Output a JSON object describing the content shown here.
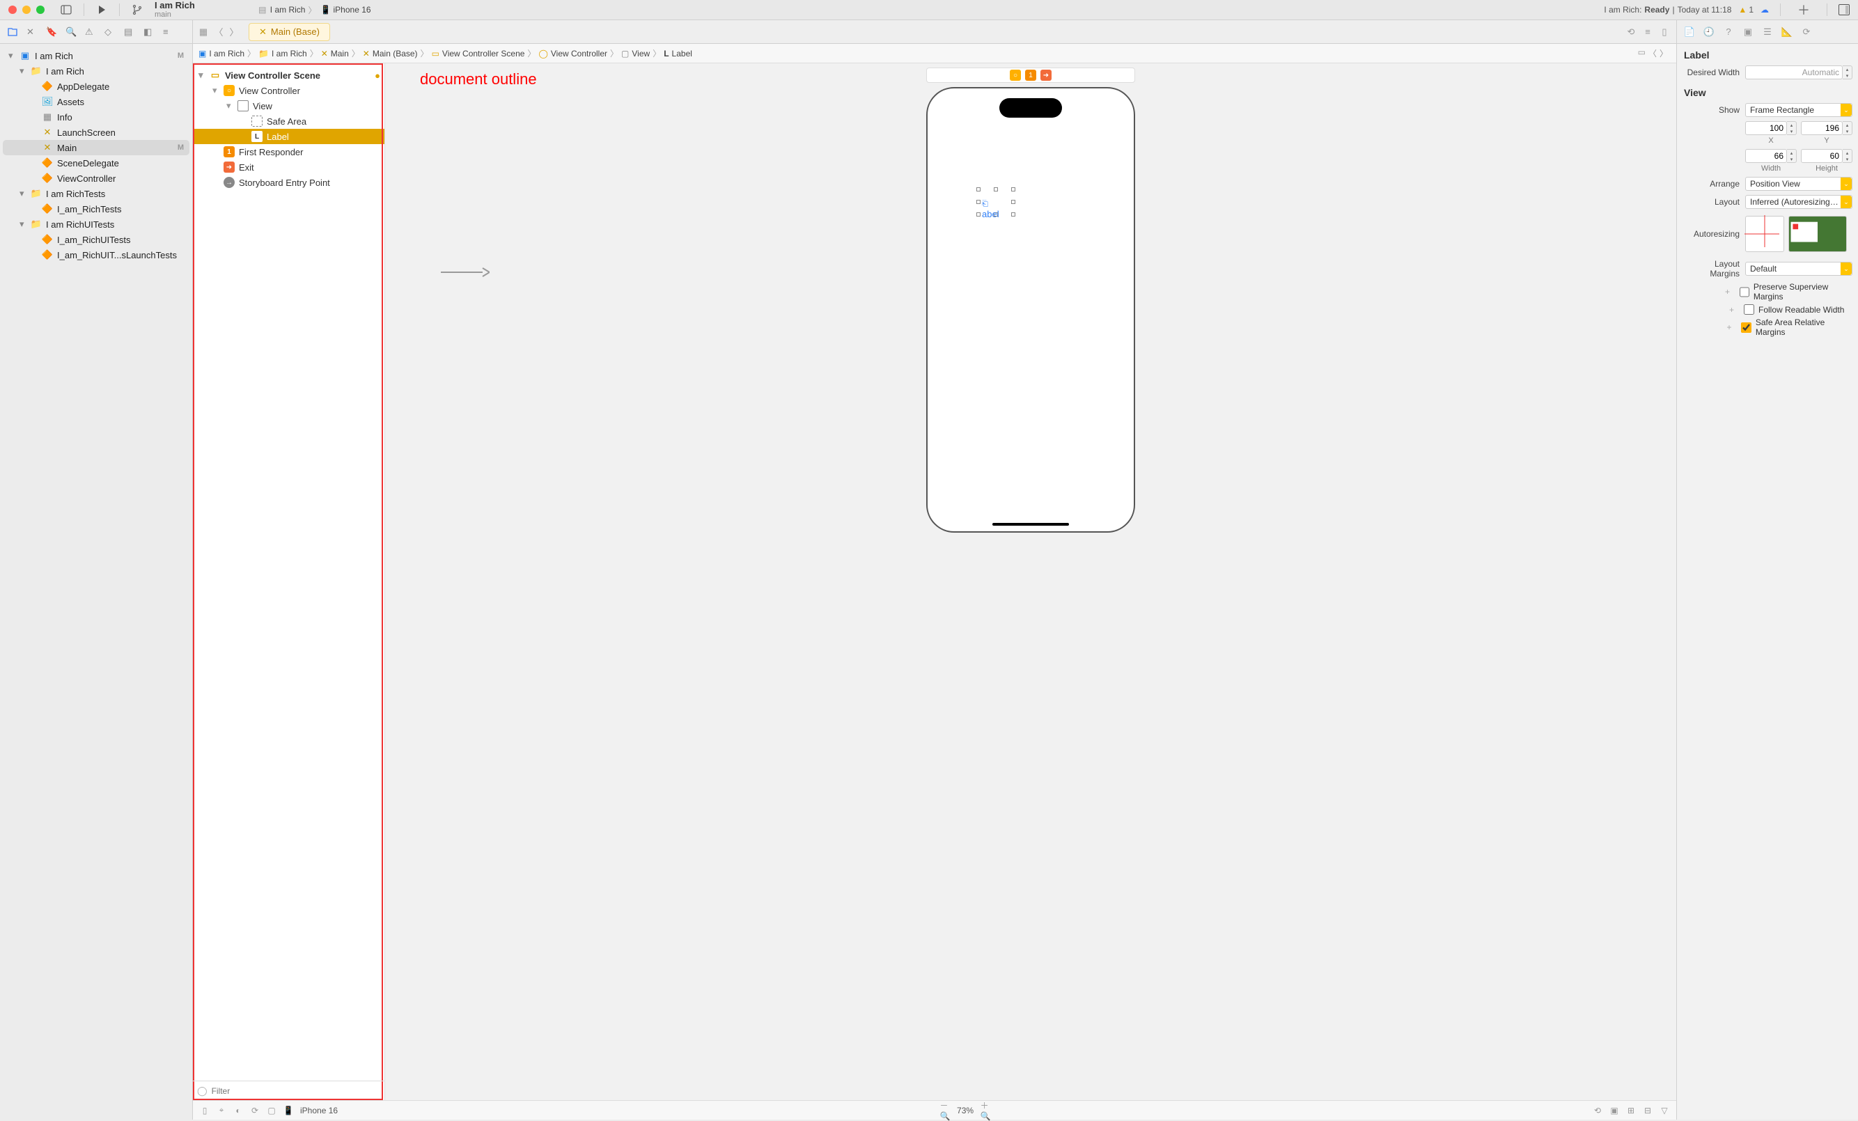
{
  "titlebar": {
    "project": "I am Rich",
    "branch": "main",
    "scheme": "I am Rich",
    "device": "iPhone 16",
    "status_prefix": "I am Rich:",
    "status_state": "Ready",
    "status_sep": "|",
    "status_time": "Today at 11:18",
    "warning_count": "1"
  },
  "navigator": {
    "project": "I am Rich",
    "project_m": "M",
    "folder1": "I am Rich",
    "items1": [
      "AppDelegate",
      "Assets",
      "Info",
      "LaunchScreen",
      "Main",
      "SceneDelegate",
      "ViewController"
    ],
    "main_m": "M",
    "folder2": "I am RichTests",
    "items2": [
      "I_am_RichTests"
    ],
    "folder3": "I am RichUITests",
    "items3": [
      "I_am_RichUITests",
      "I_am_RichUIT...sLaunchTests"
    ]
  },
  "tab": {
    "file": "Main (Base)"
  },
  "breadcrumb": {
    "items": [
      "I am Rich",
      "I am Rich",
      "Main",
      "Main (Base)",
      "View Controller Scene",
      "View Controller",
      "View",
      "Label"
    ]
  },
  "outline": {
    "scene": "View Controller Scene",
    "vc": "View Controller",
    "view": "View",
    "safe": "Safe Area",
    "label": "Label",
    "first": "First Responder",
    "exit": "Exit",
    "entry": "Storyboard Entry Point",
    "filter_ph": "Filter"
  },
  "annotation": "document outline",
  "canvas": {
    "label_text": "abel",
    "footer_device": "iPhone 16",
    "footer_zoom": "73%"
  },
  "inspector": {
    "h1": "Label",
    "desired_width": "Desired Width",
    "desired_width_val": "Automatic",
    "h2": "View",
    "show": "Show",
    "show_val": "Frame Rectangle",
    "x": "100",
    "y": "196",
    "w": "66",
    "hv": "60",
    "xl": "X",
    "yl": "Y",
    "wl": "Width",
    "hl": "Height",
    "arrange": "Arrange",
    "arrange_val": "Position View",
    "layout": "Layout",
    "layout_val": "Inferred (Autoresizing Mas...",
    "auto": "Autoresizing",
    "margins": "Layout Margins",
    "margins_val": "Default",
    "c1": "Preserve Superview Margins",
    "c2": "Follow Readable Width",
    "c3": "Safe Area Relative Margins"
  }
}
